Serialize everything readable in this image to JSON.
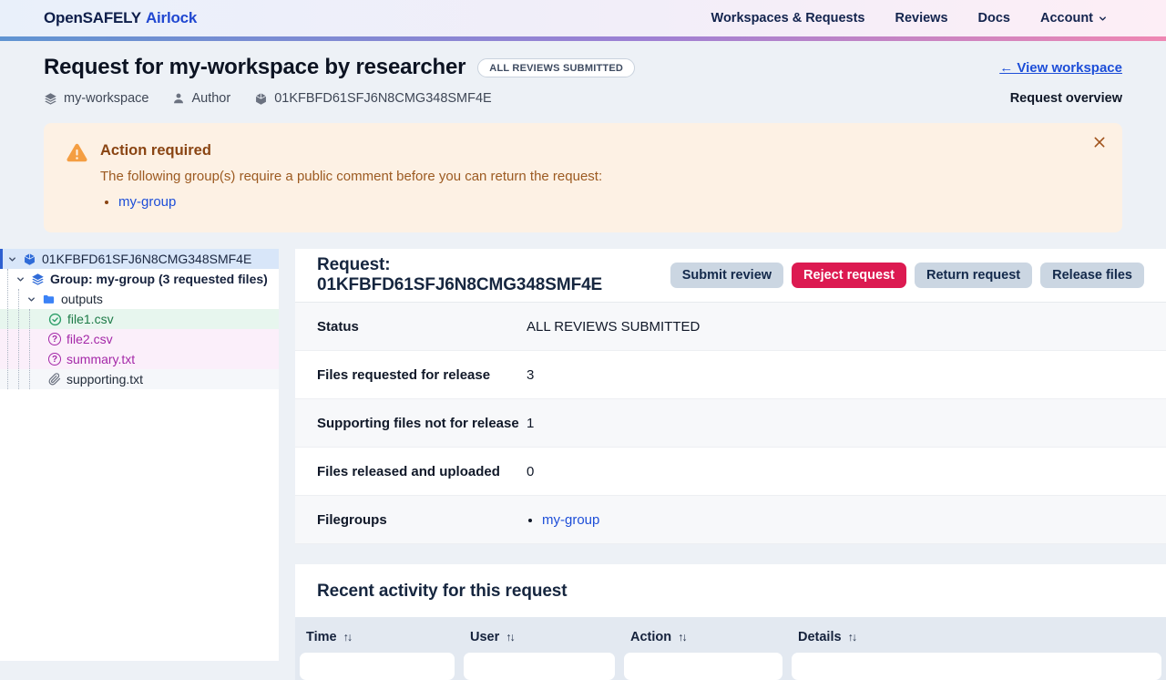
{
  "colors": {
    "brand_navy": "#0e1e4a",
    "brand_blue": "#2148d1",
    "accent_link": "#1d4ed8",
    "page_bg": "#edf1f6",
    "alert_bg": "#fdf1e4",
    "alert_title": "#8a4513",
    "alert_text": "#9c5a21",
    "warning_orange": "#f49e42",
    "danger": "#dc1a51",
    "button_bg": "#cbd6e2",
    "button_text": "#13294b",
    "selected_row_bg": "#d8e6f9",
    "selected_row_border": "#2d5fd0",
    "approved_green": "#1d7a47",
    "approved_bg": "#e7f6ee",
    "question_purple": "#a428a8",
    "question_bg": "#fbeffa",
    "table_header_bg": "#e3e9f1",
    "row_alt_bg": "#f7f8fa"
  },
  "navbar": {
    "brand_primary": "OpenSAFELY",
    "brand_secondary": "Airlock",
    "links": [
      {
        "label": "Workspaces & Requests"
      },
      {
        "label": "Reviews"
      },
      {
        "label": "Docs"
      },
      {
        "label": "Account"
      }
    ]
  },
  "header": {
    "title": "Request for my-workspace by researcher",
    "status_badge": "ALL REVIEWS SUBMITTED",
    "view_workspace_link": "← View workspace",
    "overview_label": "Request overview",
    "meta": {
      "workspace": "my-workspace",
      "author": "Author",
      "request_id": "01KFBFD61SFJ6N8CMG348SMF4E"
    }
  },
  "alert": {
    "title": "Action required",
    "message": "The following group(s) require a public comment before you can return the request:",
    "groups": [
      {
        "label": "my-group"
      }
    ]
  },
  "tree": {
    "request_label": "01KFBFD61SFJ6N8CMG348SMF4E",
    "group_label": "Group: my-group (3 requested files)",
    "folder_label": "outputs",
    "files": [
      {
        "name": "file1.csv",
        "state": "approved"
      },
      {
        "name": "file2.csv",
        "state": "undecided"
      },
      {
        "name": "summary.txt",
        "state": "undecided"
      },
      {
        "name": "supporting.txt",
        "state": "supporting"
      }
    ]
  },
  "main": {
    "title": "Request: 01KFBFD61SFJ6N8CMG348SMF4E",
    "buttons": [
      {
        "label": "Submit review",
        "variant": "default"
      },
      {
        "label": "Reject request",
        "variant": "danger"
      },
      {
        "label": "Return request",
        "variant": "default"
      },
      {
        "label": "Release files",
        "variant": "default"
      }
    ],
    "details": [
      {
        "label": "Status",
        "value": "ALL REVIEWS SUBMITTED"
      },
      {
        "label": "Files requested for release",
        "value": "3"
      },
      {
        "label": "Supporting files not for release",
        "value": "1"
      },
      {
        "label": "Files released and uploaded",
        "value": "0"
      },
      {
        "label": "Filegroups",
        "value": "my-group"
      }
    ],
    "activity": {
      "title": "Recent activity for this request",
      "columns": [
        {
          "label": "Time"
        },
        {
          "label": "User"
        },
        {
          "label": "Action"
        },
        {
          "label": "Details"
        }
      ],
      "sort_icon": "↑↓"
    }
  }
}
